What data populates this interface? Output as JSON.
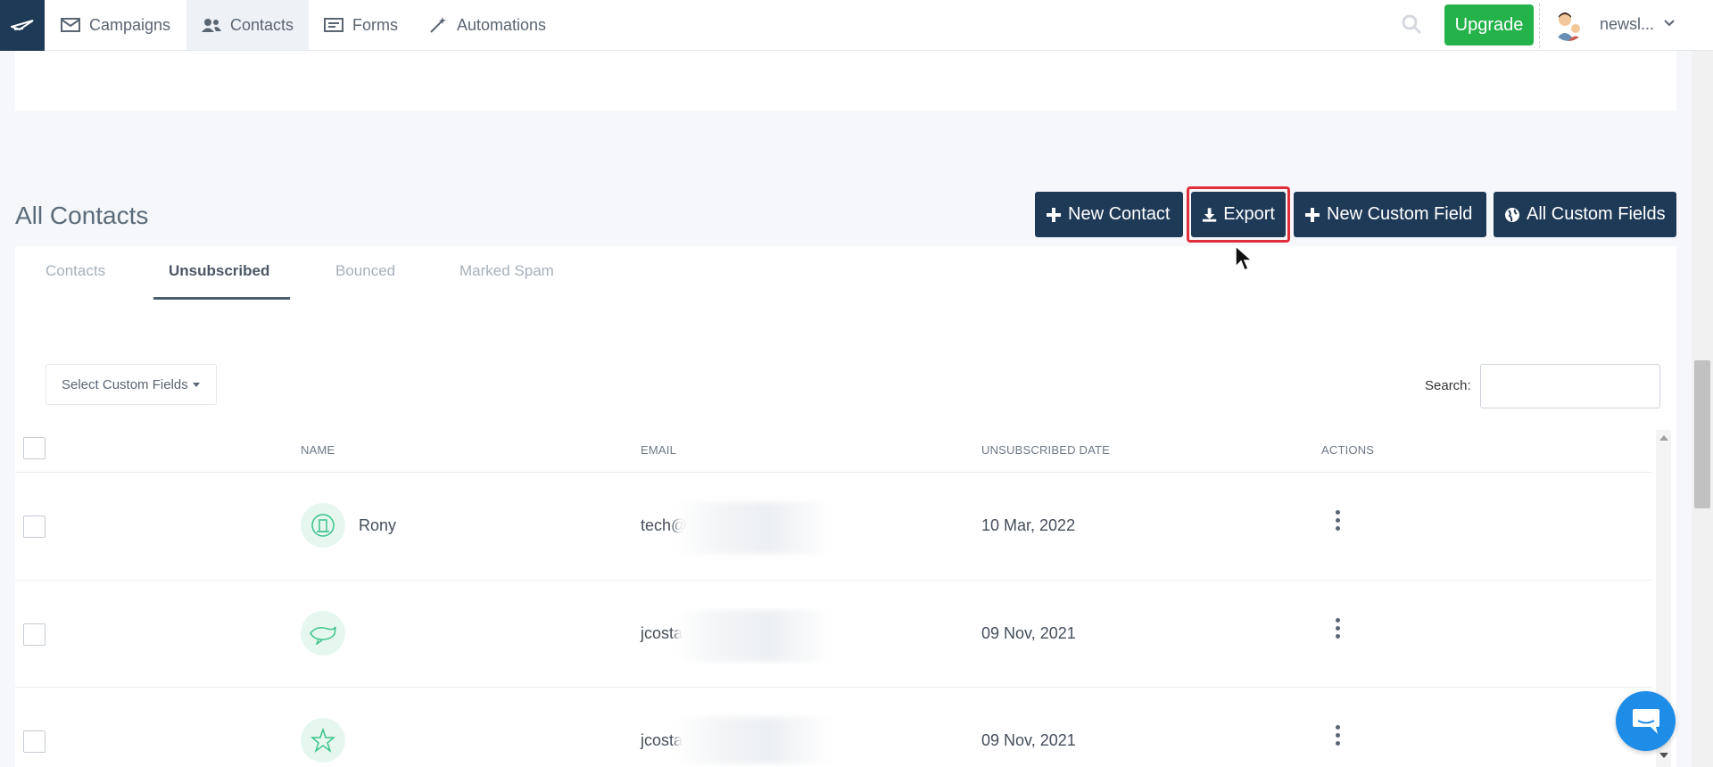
{
  "nav": {
    "items": [
      {
        "label": "Campaigns",
        "icon": "envelope-icon"
      },
      {
        "label": "Contacts",
        "icon": "users-icon",
        "active": true
      },
      {
        "label": "Forms",
        "icon": "form-icon"
      },
      {
        "label": "Automations",
        "icon": "magic-wand-icon"
      }
    ],
    "upgrade_label": "Upgrade",
    "account_name": "newsl..."
  },
  "page": {
    "title": "All Contacts",
    "buttons": {
      "new_contact": "New Contact",
      "export": "Export",
      "new_custom_field": "New Custom Field",
      "all_custom_fields": "All Custom Fields"
    }
  },
  "tabs": [
    {
      "label": "Contacts"
    },
    {
      "label": "Unsubscribed",
      "active": true
    },
    {
      "label": "Bounced"
    },
    {
      "label": "Marked Spam"
    }
  ],
  "filters": {
    "select_custom_fields": "Select Custom Fields",
    "search_label": "Search:"
  },
  "table": {
    "headers": [
      "NAME",
      "EMAIL",
      "UNSUBSCRIBED DATE",
      "ACTIONS"
    ],
    "rows": [
      {
        "name": "Rony",
        "email": "tech@",
        "date": "10 Mar, 2022"
      },
      {
        "name": "",
        "email": "jcosta",
        "date": "09 Nov, 2021"
      },
      {
        "name": "",
        "email": "jcosta",
        "date": "09 Nov, 2021"
      }
    ]
  },
  "colors": {
    "navy": "#1f3a57",
    "upgrade_green": "#24b34b",
    "highlight_red": "#e02f3a",
    "chat_blue": "#1e8de8"
  }
}
